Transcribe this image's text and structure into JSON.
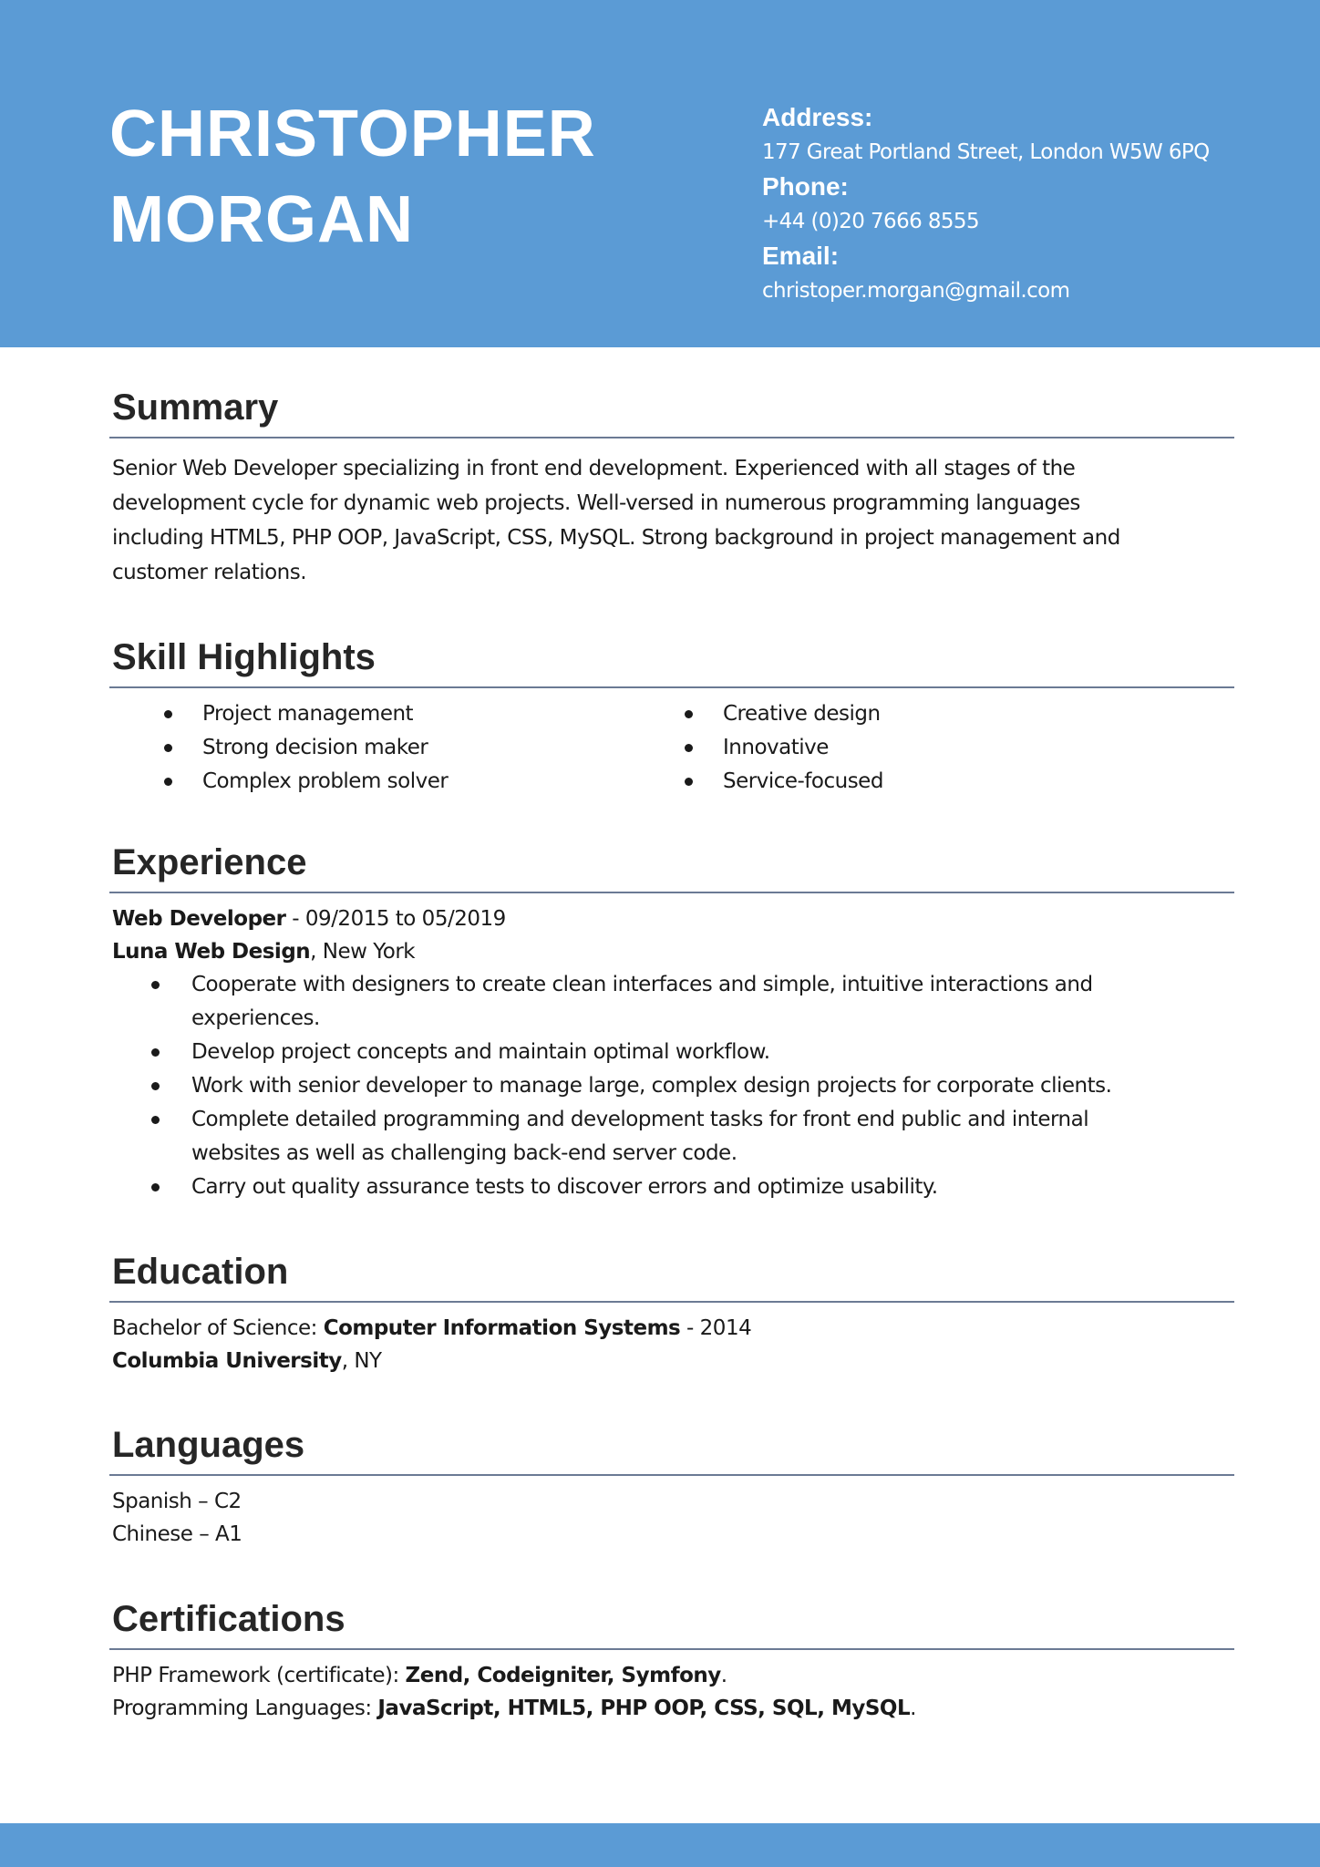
{
  "colors": {
    "accent": "#5b9bd5",
    "heading": "#262626",
    "rule": "#6b7a94"
  },
  "header": {
    "name_line1": "CHRISTOPHER",
    "name_line2": "MORGAN",
    "address_label": "Address:",
    "address": "177 Great Portland Street, London W5W 6PQ",
    "phone_label": "Phone:",
    "phone": "+44 (0)20 7666 8555",
    "email_label": "Email:",
    "email": "christoper.morgan@gmail.com"
  },
  "summary": {
    "title": "Summary",
    "lines": [
      "Senior Web Developer specializing in front end development. Experienced with all stages of the",
      "development cycle for dynamic web projects. Well-versed in numerous programming languages",
      "including HTML5, PHP OOP, JavaScript, CSS, MySQL. Strong background in project management and",
      "customer relations."
    ]
  },
  "skills": {
    "title": "Skill Highlights",
    "left": [
      "Project management",
      "Strong decision maker",
      "Complex problem solver"
    ],
    "right": [
      "Creative design",
      "Innovative",
      "Service-focused"
    ]
  },
  "experience": {
    "title": "Experience",
    "job_title": "Web Developer",
    "dates": " - 09/2015 to 05/2019",
    "company": "Luna Web Design",
    "location": ", New York",
    "bullets": [
      [
        "Cooperate with designers to create clean interfaces and simple, intuitive interactions and",
        "experiences."
      ],
      [
        "Develop project concepts and maintain optimal workflow."
      ],
      [
        "Work with senior developer to manage large, complex design projects for corporate clients."
      ],
      [
        "Complete detailed programming and development tasks for front end public and internal",
        "websites as well as challenging back-end server code."
      ],
      [
        "Carry out quality assurance tests to discover errors and optimize usability."
      ]
    ]
  },
  "education": {
    "title": "Education",
    "degree_prefix": "Bachelor of Science: ",
    "degree": "Computer Information Systems",
    "year": " - 2014",
    "school": "Columbia University",
    "school_location": ", NY"
  },
  "languages": {
    "title": "Languages",
    "items": [
      "Spanish – C2",
      "Chinese – A1"
    ]
  },
  "certifications": {
    "title": "Certifications",
    "cert1_prefix": "PHP Framework (certificate): ",
    "cert1_value": "Zend, Codeigniter, Symfony",
    "cert1_suffix": ".",
    "cert2_prefix": "Programming Languages: ",
    "cert2_value": "JavaScript, HTML5, PHP OOP, CSS, SQL, MySQL",
    "cert2_suffix": "."
  }
}
